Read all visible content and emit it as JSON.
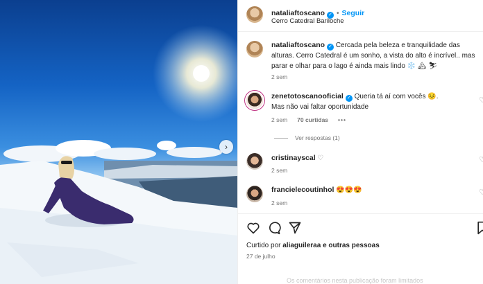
{
  "photo": {
    "next_icon": "chevron-right-icon"
  },
  "header": {
    "username": "nataliaftoscano",
    "separator": "•",
    "follow_label": "Seguir",
    "location": "Cerro Catedral Bariloche",
    "verified_icon": "verified-badge-icon"
  },
  "caption": {
    "username": "nataliaftoscano",
    "text": "Cercada pela beleza e tranquilidade das alturas. Cerro Catedral é um sonho, a vista do alto é incrível.. mas parar e olhar para o lago é ainda mais lindo ❄️ 🏔 ⛷",
    "time": "2 sem"
  },
  "comments": [
    {
      "username": "zenetotoscanooficial",
      "text_line1": "Queria tá aí com vocês 😣.",
      "text_line2": "Mas não vai faltar oportunidade",
      "time": "2 sem",
      "likes": "70 curtidas",
      "more": "•••",
      "view_replies": "Ver respostas (1)"
    },
    {
      "username": "cristinayscal",
      "text": "♡",
      "time": "2 sem"
    },
    {
      "username": "francielecoutinhol",
      "text": "😍😍😍",
      "time": "2 sem"
    }
  ],
  "actions": {
    "like_icon": "heart-icon",
    "comment_icon": "comment-icon",
    "share_icon": "send-icon",
    "save_icon": "bookmark-icon",
    "liked_by_prefix": "Curtido por",
    "liked_by_user": "aliaguileraa",
    "liked_by_suffix": "e outras pessoas",
    "date": "27 de julho",
    "comments_limited": "Os comentários nesta publicação foram limitados"
  },
  "colors": {
    "accent": "#0095f6",
    "secondary_text": "#737373"
  }
}
